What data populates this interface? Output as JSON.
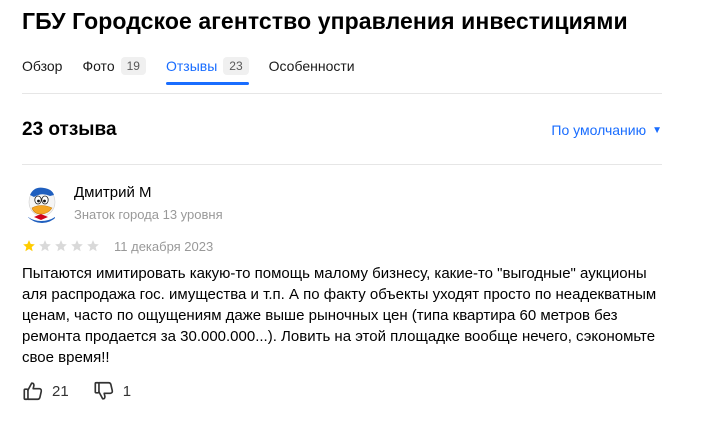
{
  "organization": {
    "title": "ГБУ Городское агентство управления инвестициями"
  },
  "tabs": [
    {
      "label": "Обзор",
      "count": null,
      "active": false
    },
    {
      "label": "Фото",
      "count": "19",
      "active": false
    },
    {
      "label": "Отзывы",
      "count": "23",
      "active": true
    },
    {
      "label": "Особенности",
      "count": null,
      "active": false
    }
  ],
  "reviews_header": {
    "title": "23 отзыва",
    "sort_label": "По умолчанию"
  },
  "review": {
    "author_name": "Дмитрий М",
    "author_level": "Знаток города 13 уровня",
    "rating": 1,
    "rating_max": 5,
    "date": "11 декабря 2023",
    "text": "Пытаются имитировать какую-то помощь малому бизнесу, какие-то \"выгодные\" аукционы аля распродажа гос. имущества и т.п. А по факту объекты уходят просто по неадекватным ценам, часто по ощущениям даже выше рыночных цен (типа квартира 60 метров без ремонта продается за 30.000.000...). Ловить на этой площадке вообще нечего, сэкономьте свое время!!",
    "likes": "21",
    "dislikes": "1"
  },
  "colors": {
    "accent": "#196dff",
    "star_filled": "#fc0",
    "star_empty": "#d9d9d9",
    "muted_text": "#999999"
  },
  "icons": {
    "like": "thumbs-up-icon",
    "dislike": "thumbs-down-icon",
    "sort": "caret-down-icon",
    "star": "star-icon"
  }
}
